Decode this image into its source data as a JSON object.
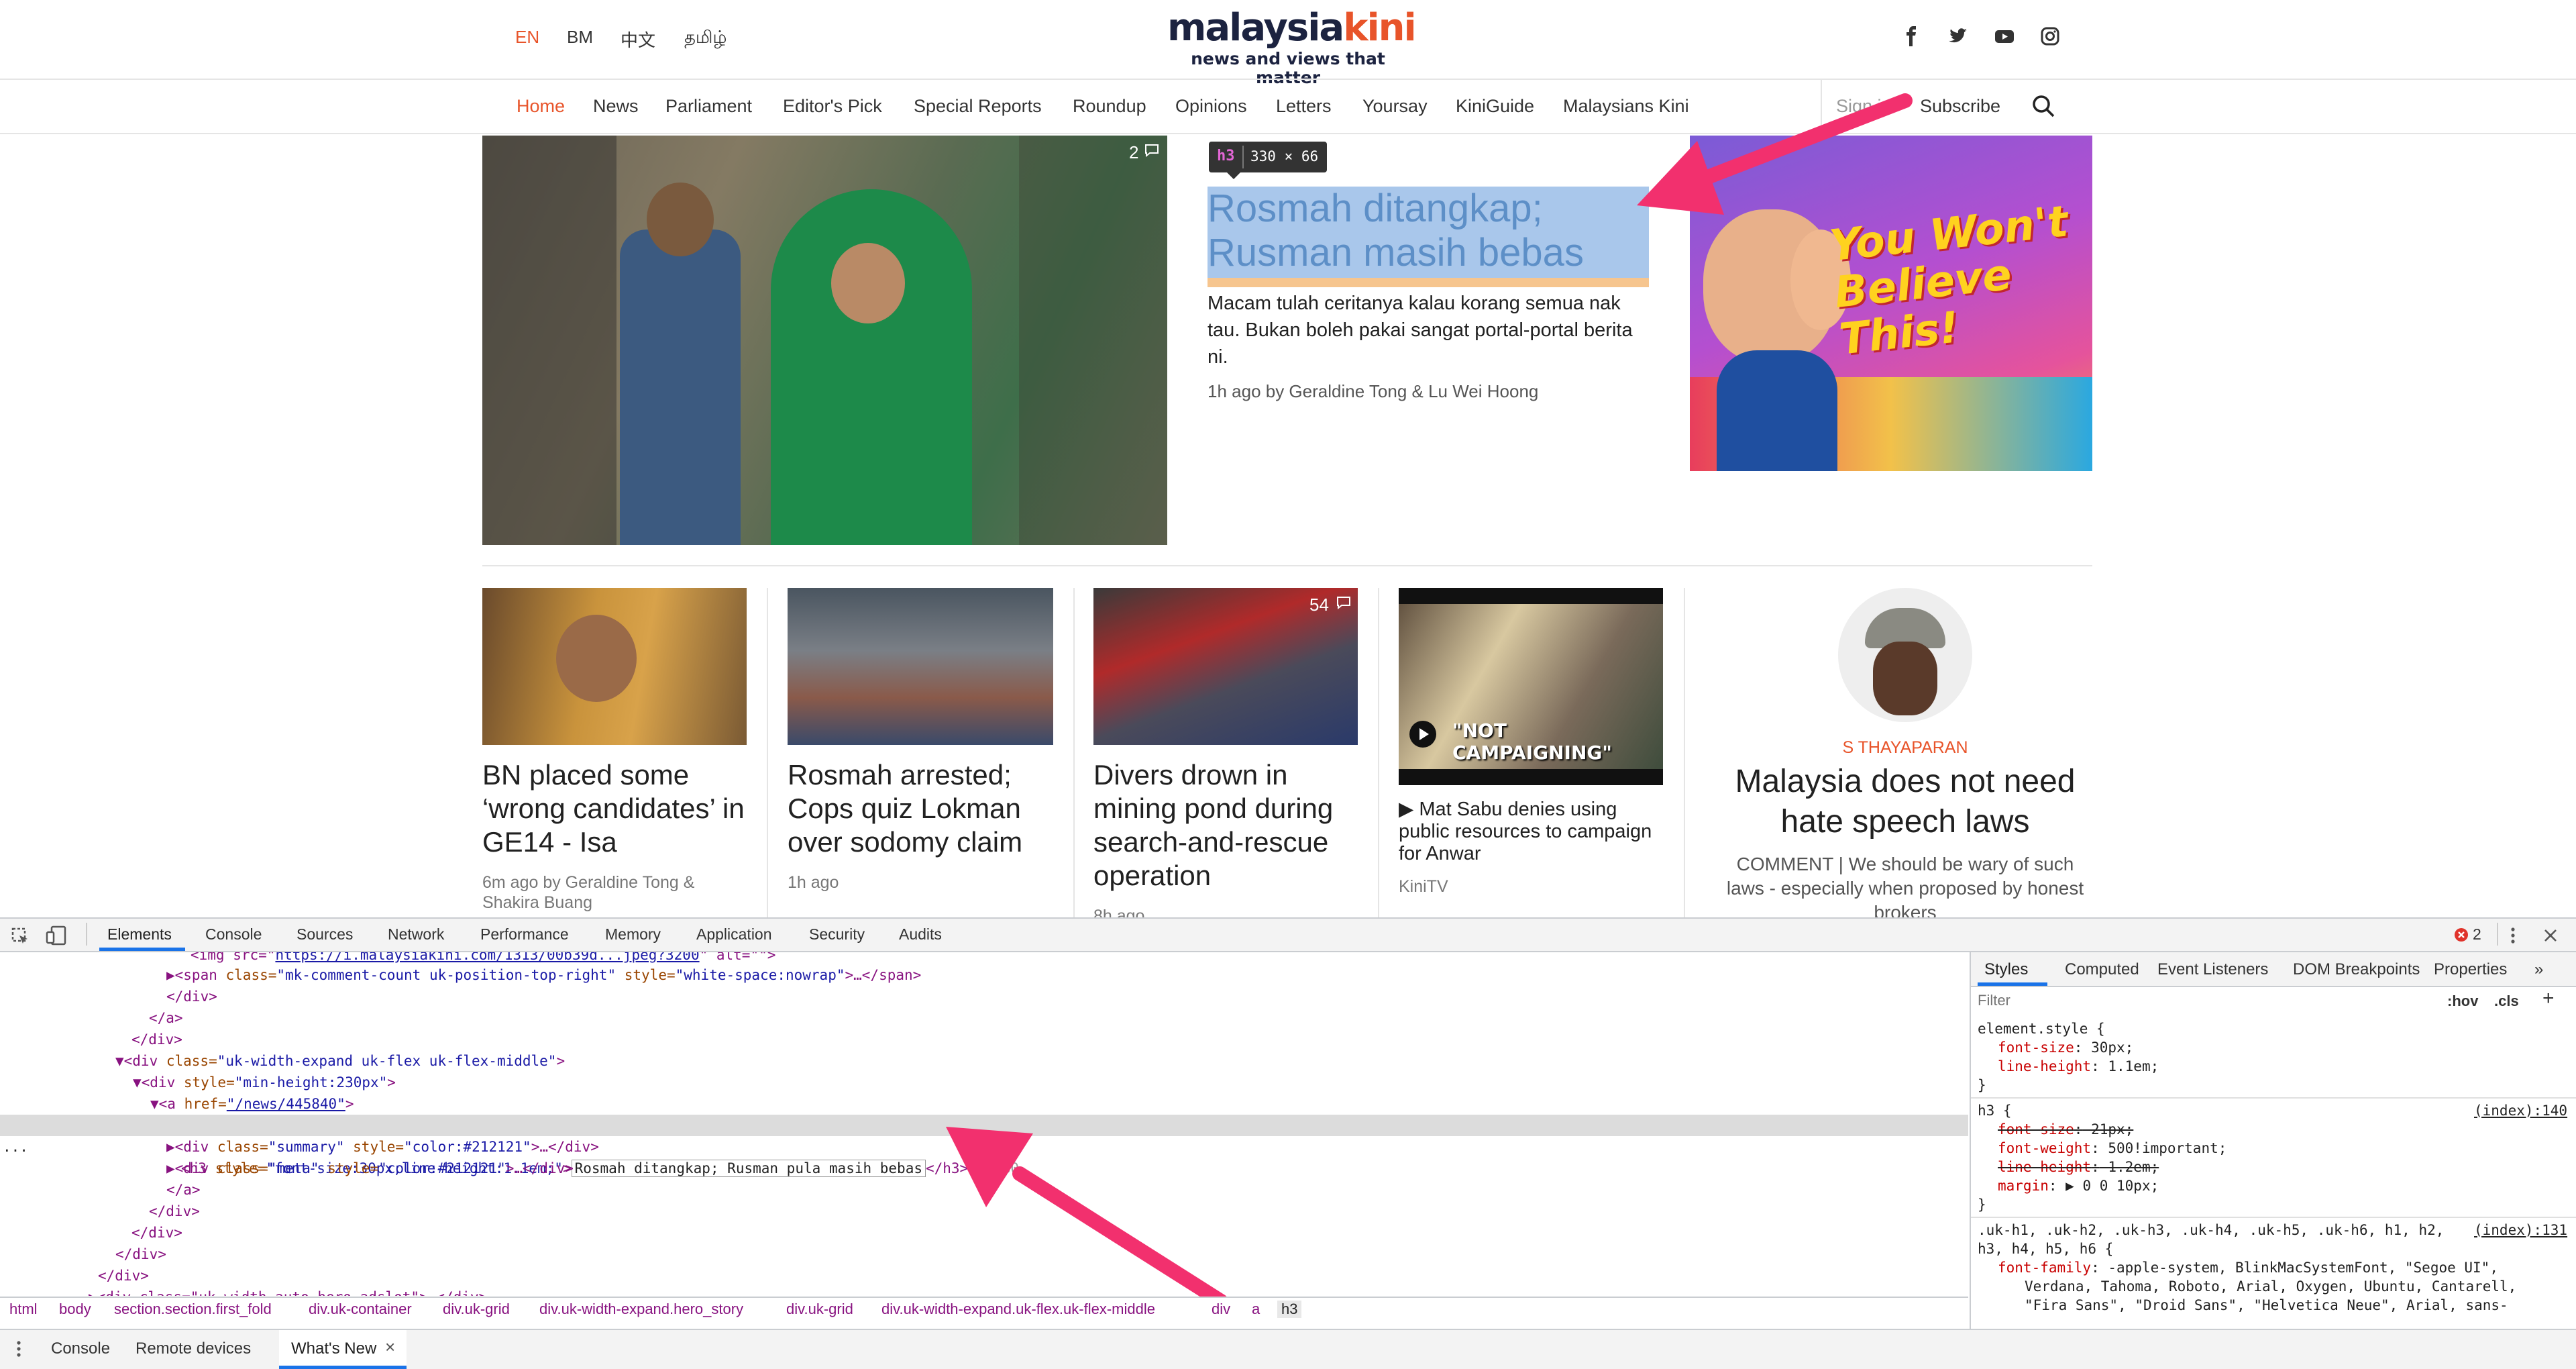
{
  "site": {
    "languages": [
      "EN",
      "BM",
      "中文",
      "தமிழ்"
    ],
    "logo_part1": "malaysia",
    "logo_part2": "kini",
    "tagline": "news and views that matter",
    "social_icons": [
      "facebook-icon",
      "twitter-icon",
      "youtube-icon",
      "instagram-icon"
    ],
    "nav": [
      "Home",
      "News",
      "Parliament",
      "Editor's Pick",
      "Special Reports",
      "Roundup",
      "Opinions",
      "Letters",
      "Yoursay",
      "KiniGuide",
      "Malaysians Kini"
    ],
    "sign_in": "Sign in",
    "subscribe": "Subscribe"
  },
  "hero": {
    "comment_count": "2",
    "tooltip_tag": "h3",
    "tooltip_size": "330 × 66",
    "headline": "Rosmah ditangkap; Rusman masih bebas",
    "summary": "Macam tulah ceritanya kalau korang semua nak tau. Bukan boleh pakai sangat portal-portal berita ni.",
    "meta": "1h ago by Geraldine Tong & Lu Wei Hoong",
    "ad_text_line1": "You Won't",
    "ad_text_line2": "Believe This!"
  },
  "stories": [
    {
      "title": "BN placed some ‘wrong candidates’ in GE14 - Isa",
      "meta": "6m ago by Geraldine Tong & Shakira Buang"
    },
    {
      "title": "Rosmah arrested; Cops quiz Lokman over sodomy claim",
      "meta": "1h ago"
    },
    {
      "title": "Divers drown in mining pond during search-and-rescue operation",
      "meta": "8h ago",
      "comment_count": "54"
    },
    {
      "title": "▶ Mat Sabu denies using public resources to campaign for Anwar",
      "meta": "KiniTV",
      "video_caption": "\"NOT CAMPAIGNING\""
    }
  ],
  "column": {
    "author": "S THAYAPARAN",
    "title": "Malaysia does not need hate speech laws",
    "summary": "COMMENT | We should be wary of such laws - especially when proposed by honest brokers"
  },
  "devtools": {
    "tabs": [
      "Elements",
      "Console",
      "Sources",
      "Network",
      "Performance",
      "Memory",
      "Application",
      "Security",
      "Audits"
    ],
    "error_count": "2",
    "code": {
      "l0_tag": "<img src=\"",
      "l0_link": "https://i.malaysiakini.com/1313/00b39d...jpeg?3200",
      "l0_rest": "\" alt=\"\">",
      "l1_pre": "▶<span ",
      "l1_a1": "class=",
      "l1_v1": "\"mk-comment-count uk-position-top-right\"",
      "l1_a2": " style=",
      "l1_v2": "\"white-space:nowrap\"",
      "l1_end": ">…</span>",
      "l2": "</div>",
      "l3": "</a>",
      "l4": "</div>",
      "l5_pre": "▼<div ",
      "l5_a": "class=",
      "l5_v": "\"uk-width-expand uk-flex uk-flex-middle\"",
      "l5_end": ">",
      "l6_pre": "▼<div ",
      "l6_a": "style=",
      "l6_v": "\"min-height:230px\"",
      "l6_end": ">",
      "l7_pre": "▼<a ",
      "l7_a": "href=",
      "l7_v": "\"/news/445840\"",
      "l7_end": ">",
      "l8_dots": "...",
      "l8_pre": "<h3 ",
      "l8_a": "style=",
      "l8_v": "\"font-size:30px;line-height:1.1em;\"",
      "l8_gt": ">",
      "l8_edit": "Rosmah ditangkap; Rusman pula masih bebas",
      "l8_end": "</h3>",
      "l8_eq": " == $0",
      "l9_pre": "▶<div ",
      "l9_a1": "class=",
      "l9_v1": "\"summary\"",
      "l9_a2": " style=",
      "l9_v2": "\"color:#212121\"",
      "l9_end": ">…</div>",
      "l10_pre": "▶<div ",
      "l10_a1": "class=",
      "l10_v1": "\"meta\"",
      "l10_a2": " style=",
      "l10_v2": "\"color:#212121\"",
      "l10_end": ">…</div>",
      "l11": "</a>",
      "l12": "</div>",
      "l13": "</div>",
      "l14": "</div>",
      "l15": "</div>",
      "l16": "▶<div class=\"uk-width-auto hero_adslot\">…</div>"
    },
    "breadcrumbs": [
      "html",
      "body",
      "section.section.first_fold",
      "div.uk-container",
      "div.uk-grid",
      "div.uk-width-expand.hero_story",
      "div.uk-grid",
      "div.uk-width-expand.uk-flex.uk-flex-middle",
      "div",
      "a",
      "h3"
    ],
    "styles_tabs": [
      "Styles",
      "Computed",
      "Event Listeners",
      "DOM Breakpoints",
      "Properties"
    ],
    "filter_placeholder": "Filter",
    "hov": ":hov",
    "cls": ".cls",
    "rules": {
      "r1_sel": "element.style {",
      "r1_p1": "font-size",
      "r1_v1": " 30px;",
      "r1_p2": "line-height",
      "r1_v2": " 1.1em;",
      "close": "}",
      "r2_sel": "h3 {",
      "r2_src": "(index):140",
      "r2_p1": "font-size",
      "r2_v1": " 21px;",
      "r2_p2": "font-weight",
      "r2_v2": " 500!important;",
      "r2_p3": "line-height",
      "r2_v3": " 1.2em;",
      "r2_p4": "margin",
      "r2_v4": " ▶ 0 0 10px;",
      "r3_sel1": ".uk-h1, .uk-h2, .uk-h3, .uk-h4, .uk-h5, .uk-h6, h1, h2,",
      "r3_src": "(index):131",
      "r3_sel2": "h3, h4, h5, h6 {",
      "r3_p1": "font-family",
      "r3_v1": " -apple-system, BlinkMacSystemFont, \"Segoe UI\",",
      "r3_v2": "Verdana, Tahoma, Roboto, Arial, Oxygen, Ubuntu, Cantarell,",
      "r3_v3": "\"Fira Sans\", \"Droid Sans\", \"Helvetica Neue\", Arial, sans-"
    },
    "drawer_tabs": [
      "Console",
      "Remote devices",
      "What's New"
    ]
  },
  "colors": {
    "accent": "#e8542a",
    "logo_navy": "#1c2340",
    "annotation_arrow": "#f2306e",
    "highlight": "#a9c7eb",
    "devtools_blue": "#1a73e8"
  }
}
